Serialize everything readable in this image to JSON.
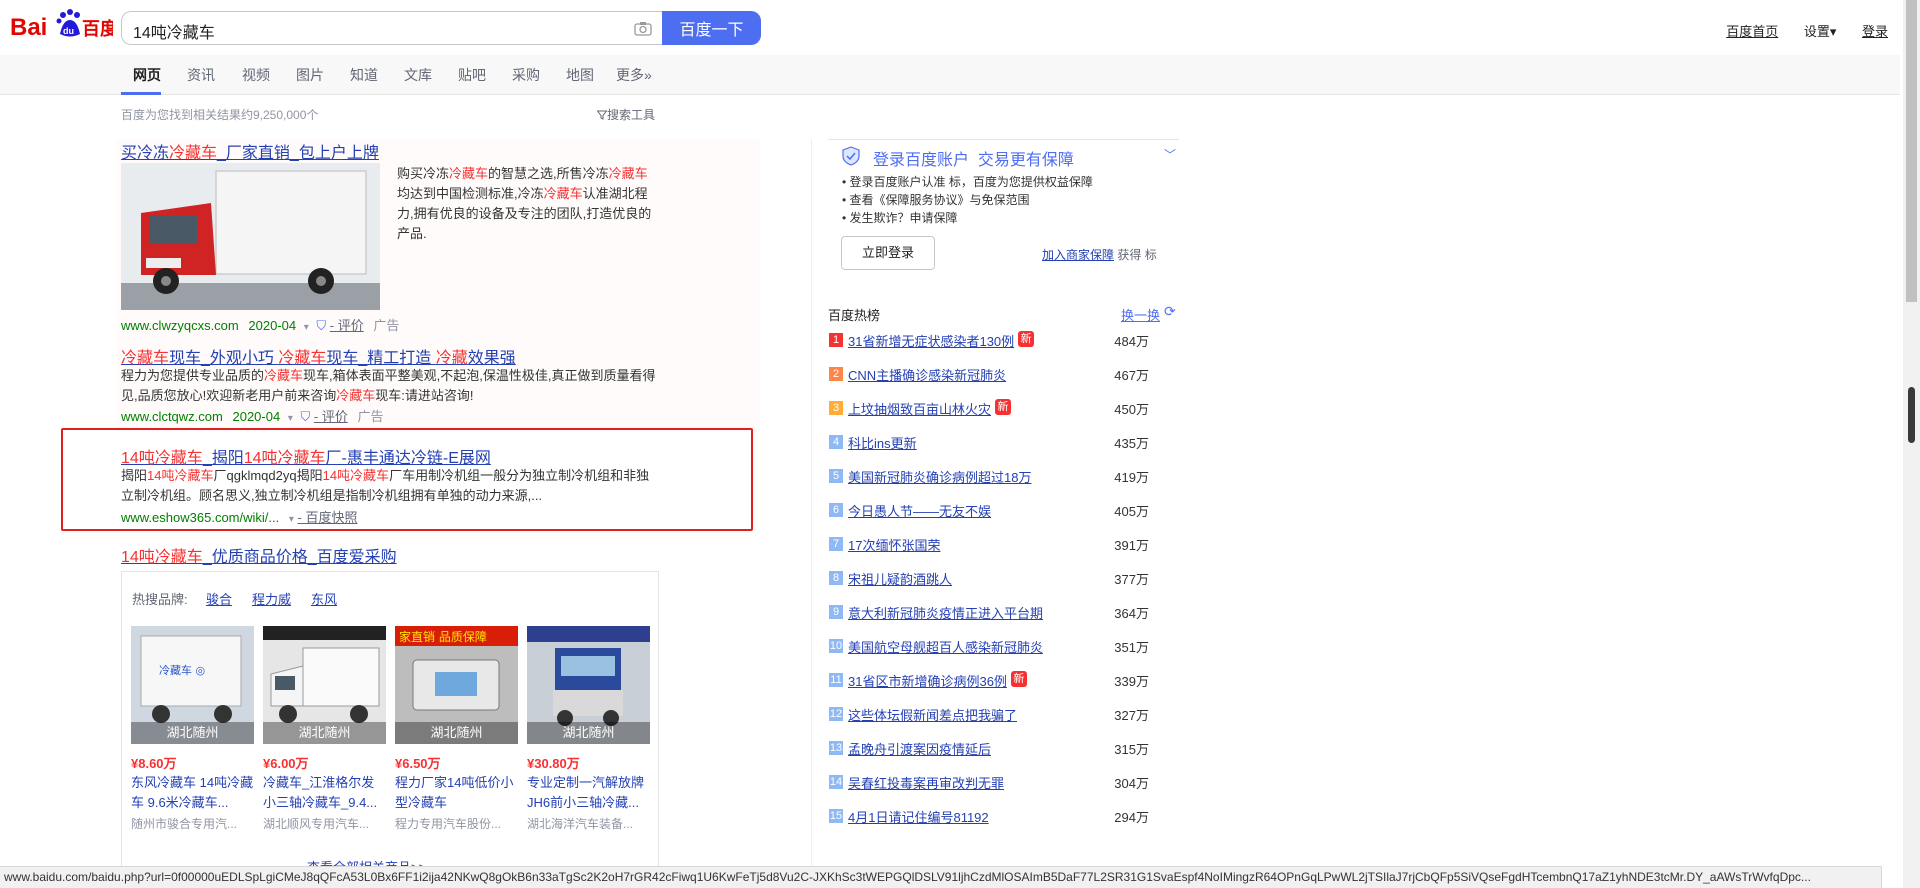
{
  "header": {
    "logo_text": "Baidu百度",
    "query": "14吨冷藏车",
    "search_button": "百度一下",
    "links": [
      "百度首页",
      "设置▾",
      "登录"
    ]
  },
  "tabs": [
    "网页",
    "资讯",
    "视频",
    "图片",
    "知道",
    "文库",
    "贴吧",
    "采购",
    "地图",
    "更多»"
  ],
  "result_count": "百度为您找到相关结果约9,250,000个",
  "search_tools": "搜索工具",
  "ad1": {
    "title_pre": "买冷冻",
    "title_red": "冷藏车",
    "title_post": "_厂家直销_包上户上牌",
    "desc": [
      {
        "t": "购买冷冻",
        "r": false
      },
      {
        "t": "冷藏车",
        "r": true
      },
      {
        "t": "的智慧之选,所售冷冻",
        "r": false
      },
      {
        "t": "冷藏车",
        "r": true
      },
      {
        "t": "均达到中国检测标准,冷冻",
        "r": false
      },
      {
        "t": "冷藏车",
        "r": true
      },
      {
        "t": "认准湖北程力,拥有优良的设备及专注的团队,打造优良的产品.",
        "r": false
      }
    ],
    "url": "www.clwzyqcxs.com",
    "date": "2020-04",
    "review": "- 评价",
    "ad_label": "广告"
  },
  "ad2": {
    "title_parts": [
      {
        "t": "冷藏车",
        "r": true
      },
      {
        "t": "现车_外观小巧 ",
        "r": false
      },
      {
        "t": "冷藏车",
        "r": true
      },
      {
        "t": "现车_精工打造 ",
        "r": false
      },
      {
        "t": "冷藏",
        "r": true
      },
      {
        "t": "效果强",
        "r": false
      }
    ],
    "desc": [
      {
        "t": "程力为您提供专业品质的",
        "r": false
      },
      {
        "t": "冷藏车",
        "r": true
      },
      {
        "t": "现车,箱体表面平整美观,不起泡,保温性极佳,真正做到质量看得见,品质您放心!欢迎新老用户前来咨询",
        "r": false
      },
      {
        "t": "冷藏车",
        "r": true
      },
      {
        "t": "现车:请进站咨询!",
        "r": false
      }
    ],
    "url": "www.clctqwz.com",
    "date": "2020-04",
    "review": "- 评价",
    "ad_label": "广告"
  },
  "result3": {
    "title_parts": [
      {
        "t": "14吨冷藏车",
        "r": true
      },
      {
        "t": "_揭阳",
        "r": false
      },
      {
        "t": "14吨冷藏车",
        "r": true
      },
      {
        "t": "厂-惠丰通达冷链-E展网",
        "r": false
      }
    ],
    "desc": [
      {
        "t": "揭阳",
        "r": false
      },
      {
        "t": "14吨冷藏车",
        "r": true
      },
      {
        "t": "厂qgklmqd2yq揭阳",
        "r": false
      },
      {
        "t": "14吨冷藏车",
        "r": true
      },
      {
        "t": "厂车用制冷机组一般分为独立制冷机组和非独立制冷机组。顾名思义,独立制冷机组是指制冷机组拥有单独的动力来源,...",
        "r": false
      }
    ],
    "url": "www.eshow365.com/wiki/...",
    "snapshot": "- 百度快照"
  },
  "result4": {
    "title_parts": [
      {
        "t": "14吨冷藏车",
        "r": true
      },
      {
        "t": "_优质商品价格_百度爱采购",
        "r": false
      }
    ],
    "brand_label": "热搜品牌:",
    "brands": [
      "骏合",
      "程力威",
      "东风"
    ],
    "products": [
      {
        "loc": "湖北随州",
        "price": "¥8.60万",
        "name": "东风冷藏车 14吨冷藏车 9.6米冷藏车...",
        "shop": "随州市骏合专用汽..."
      },
      {
        "loc": "湖北随州",
        "price": "¥6.00万",
        "name": "冷藏车_江淮格尔发小三轴冷藏车_9.4...",
        "shop": "湖北顺风专用汽车..."
      },
      {
        "loc": "湖北随州",
        "price": "¥6.50万",
        "name": "程力厂家14吨低价小型冷藏车",
        "shop": "程力专用汽车股份..."
      },
      {
        "loc": "湖北随州",
        "price": "¥30.80万",
        "name": "专业定制一汽解放牌JH6前小三轴冷藏...",
        "shop": "湖北海洋汽车装备..."
      }
    ],
    "more": "查看全部相关商品>>"
  },
  "login_card": {
    "title": "登录百度账户  交易更有保障",
    "lines": [
      "登录百度账户认准 标，百度为您提供权益保障",
      "查看《保障服务协议》与免保范围",
      "发生欺诈？申请保障"
    ],
    "login_button": "立即登录",
    "merchant_link": "加入商家保障",
    "merchant_suffix": "获得 标"
  },
  "hot": {
    "title": "百度热榜",
    "refresh": "换一换",
    "items": [
      {
        "n": "1",
        "t": "31省新增无症状感染者130例",
        "new": true,
        "v": "484万"
      },
      {
        "n": "2",
        "t": "CNN主播确诊感染新冠肺炎",
        "new": false,
        "v": "467万"
      },
      {
        "n": "3",
        "t": "上坟抽烟致百亩山林火灾",
        "new": true,
        "v": "450万"
      },
      {
        "n": "4",
        "t": "科比ins更新",
        "new": false,
        "v": "435万"
      },
      {
        "n": "5",
        "t": "美国新冠肺炎确诊病例超过18万",
        "new": false,
        "v": "419万"
      },
      {
        "n": "6",
        "t": "今日愚人节——无友不娱",
        "new": false,
        "v": "405万"
      },
      {
        "n": "7",
        "t": "17次缅怀张国荣",
        "new": false,
        "v": "391万"
      },
      {
        "n": "8",
        "t": "宋祖儿疑韵酒跳人",
        "new": false,
        "v": "377万"
      },
      {
        "n": "9",
        "t": "意大利新冠肺炎疫情正进入平台期",
        "new": false,
        "v": "364万"
      },
      {
        "n": "10",
        "t": "美国航空母舰超百人感染新冠肺炎",
        "new": false,
        "v": "351万"
      },
      {
        "n": "11",
        "t": "31省区市新增确诊病例36例",
        "new": true,
        "v": "339万"
      },
      {
        "n": "12",
        "t": "这些体坛假新闻差点把我骗了",
        "new": false,
        "v": "327万"
      },
      {
        "n": "13",
        "t": "孟晚舟引渡案因疫情延后",
        "new": false,
        "v": "315万"
      },
      {
        "n": "14",
        "t": "吴春红投毒案再审改判无罪",
        "new": false,
        "v": "304万"
      },
      {
        "n": "15",
        "t": "4月1日请记住编号81192",
        "new": false,
        "v": "294万"
      }
    ]
  },
  "status_url": "www.baidu.com/baidu.php?url=0f00000uEDLSpLgiCMeJ8qQFcA53L0Bx6FF1i2ija42NKwQ8gOkB6n33aTgSc2K2oH7rGR42cFiwq1U6KwFeTj5d8Vu2C-JXKhSc3tWEPGQlDSLV91ljhCzdMlOSAImB5DaF77L2SR31G1SvaEspf4NoIMingzR64OPnGqLPwWL2jTSIlaJ7rjCbQFp5SiVQseFgdHTcembnQ17aZ1yhNDE3tcMr.DY_aAWsTrWvfqDpc...",
  "colors": {
    "accent": "#4e6ef2",
    "link": "#2440b3",
    "red": "#f73131",
    "green": "#008000",
    "highlight": "#e02020"
  }
}
